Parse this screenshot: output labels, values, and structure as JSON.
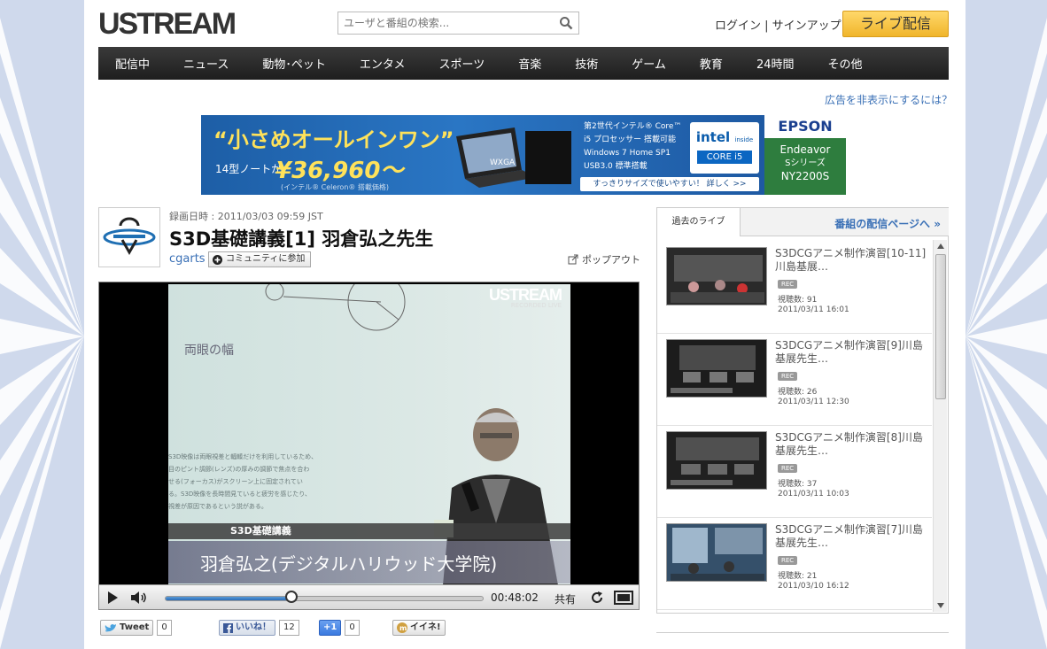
{
  "header": {
    "logo": "USTREAM",
    "search_placeholder": "ユーザと番組の検索...",
    "login": "ログイン",
    "separator": " | ",
    "signup": "サインアップ",
    "live_button": "ライブ配信"
  },
  "nav": [
    "配信中",
    "ニュース",
    "動物･ペット",
    "エンタメ",
    "スポーツ",
    "音楽",
    "技術",
    "ゲーム",
    "教育",
    "24時間",
    "その他"
  ],
  "ad_link": "広告を非表示にするには？",
  "banner": {
    "headline": "“小さめオールインワン”",
    "laptop_size": "14型ノートが",
    "price": "¥36,960～",
    "price_note": "(インテル® Celeron® 搭載価格)",
    "laptop_label": "WXGA",
    "spec_lines": [
      "第2世代インテル® Core™",
      "i5 プロセッサー 搭載可能",
      "Windows 7 Home SP1",
      "USB3.0 標準搭載"
    ],
    "detail": "すっきりサイズで使いやすい！ 詳しく >>",
    "intel_brand": "intel",
    "intel_inside": "inside",
    "intel_core": "CORE i5",
    "epson_brand": "EPSON",
    "epson_lines": [
      "Endeavor",
      "Sシリーズ",
      "NY2200S"
    ]
  },
  "show": {
    "recorded_at": "録画日時 : 2011/03/03 09:59 JST",
    "title": "S3D基礎講義[1]  羽倉弘之先生",
    "channel": "cgarts",
    "community_button": "コミュニティに参加",
    "popout": "ポップアウト"
  },
  "player": {
    "watermark": "USTREAM",
    "watermark_sub": "RECORDED LIVE",
    "slide_heading": "両眼の幅",
    "slide_text": [
      "S3D映像は両眼視差と輻輳だけを利用しているため、",
      "目のピント調節(レンズ)の厚みの調節で焦点を合わ",
      "せる(フォーカス)がスクリーン上に固定されてい",
      "る。S3D映像を長時間見ていると疲労を感じたり、",
      "視差が原因であるという説がある。"
    ],
    "caption_title": "S3D基礎講義",
    "caption_name": "羽倉弘之(デジタルハリウッド大学院)",
    "time": "00:48:02",
    "share": "共有",
    "progress": 0.4
  },
  "social": {
    "tweet": "Tweet",
    "tweet_count": "0",
    "like": "いいね！",
    "like_count": "12",
    "plus": "+1",
    "plus_count": "0",
    "iine": "イイネ!"
  },
  "sidebar": {
    "tab": "過去のライブ",
    "page_link": "番組の配信ページへ »",
    "items": [
      {
        "title": "S3DCGアニメ制作演習[10-11]川島基展…",
        "rec": "REC",
        "views": "視聴数: 91",
        "date": "2011/03/11 16:01"
      },
      {
        "title": "S3DCGアニメ制作演習[9]川島基展先生…",
        "rec": "REC",
        "views": "視聴数: 26",
        "date": "2011/03/11 12:30"
      },
      {
        "title": "S3DCGアニメ制作演習[8]川島基展先生…",
        "rec": "REC",
        "views": "視聴数: 37",
        "date": "2011/03/11 10:03"
      },
      {
        "title": "S3DCGアニメ制作演習[7]川島基展先生…",
        "rec": "REC",
        "views": "視聴数: 21",
        "date": "2011/03/10 16:12"
      }
    ]
  },
  "colors": {
    "link": "#3a70b6",
    "live_button": "#f0b52b",
    "nav_bg": "#2a2a2a",
    "banner_blue": "#2a76c4"
  }
}
